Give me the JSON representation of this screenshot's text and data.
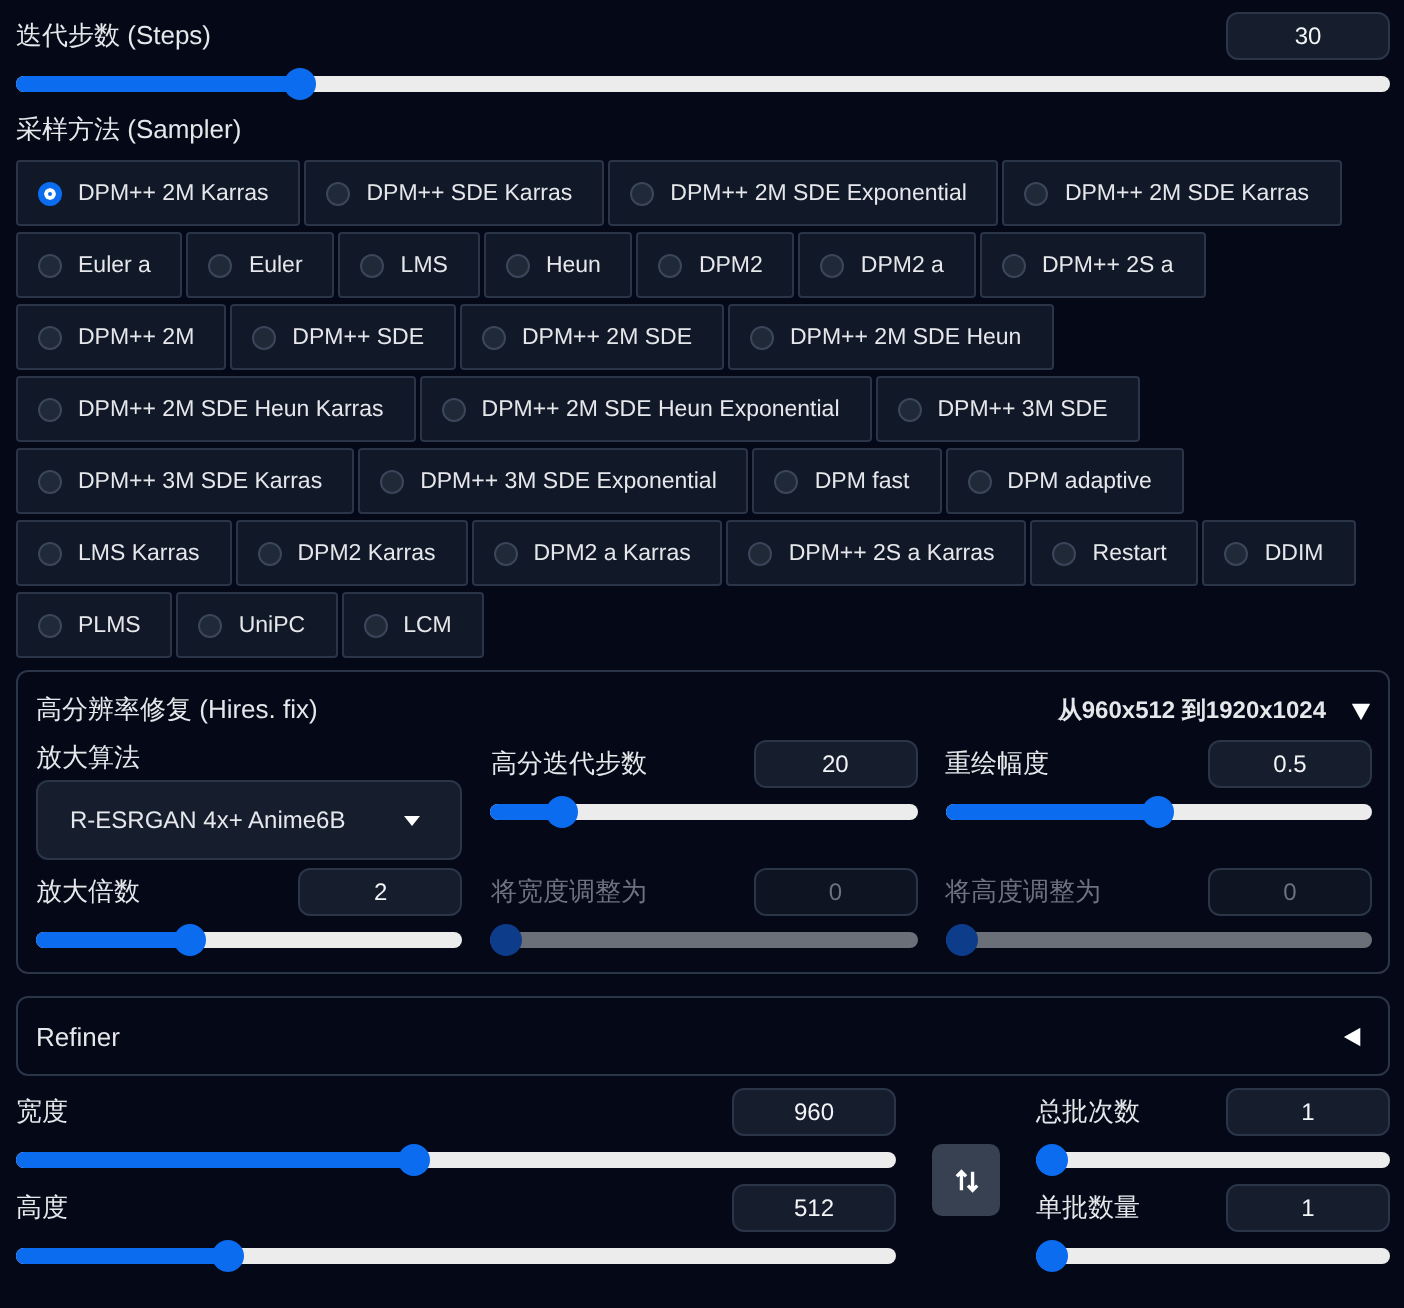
{
  "steps": {
    "label": "迭代步数 (Steps)",
    "value": "30",
    "level": 0.2
  },
  "sampler": {
    "label": "采样方法 (Sampler)",
    "options": [
      {
        "label": "DPM++ 2M Karras",
        "selected": true
      },
      {
        "label": "DPM++ SDE Karras",
        "selected": false
      },
      {
        "label": "DPM++ 2M SDE Exponential",
        "selected": false
      },
      {
        "label": "DPM++ 2M SDE Karras",
        "selected": false
      },
      {
        "label": "Euler a",
        "selected": false
      },
      {
        "label": "Euler",
        "selected": false
      },
      {
        "label": "LMS",
        "selected": false
      },
      {
        "label": "Heun",
        "selected": false
      },
      {
        "label": "DPM2",
        "selected": false
      },
      {
        "label": "DPM2 a",
        "selected": false
      },
      {
        "label": "DPM++ 2S a",
        "selected": false
      },
      {
        "label": "DPM++ 2M",
        "selected": false
      },
      {
        "label": "DPM++ SDE",
        "selected": false
      },
      {
        "label": "DPM++ 2M SDE",
        "selected": false
      },
      {
        "label": "DPM++ 2M SDE Heun",
        "selected": false
      },
      {
        "label": "DPM++ 2M SDE Heun Karras",
        "selected": false
      },
      {
        "label": "DPM++ 2M SDE Heun Exponential",
        "selected": false
      },
      {
        "label": "DPM++ 3M SDE",
        "selected": false
      },
      {
        "label": "DPM++ 3M SDE Karras",
        "selected": false
      },
      {
        "label": "DPM++ 3M SDE Exponential",
        "selected": false
      },
      {
        "label": "DPM fast",
        "selected": false
      },
      {
        "label": "DPM adaptive",
        "selected": false
      },
      {
        "label": "LMS Karras",
        "selected": false
      },
      {
        "label": "DPM2 Karras",
        "selected": false
      },
      {
        "label": "DPM2 a Karras",
        "selected": false
      },
      {
        "label": "DPM++ 2S a Karras",
        "selected": false
      },
      {
        "label": "Restart",
        "selected": false
      },
      {
        "label": "DDIM",
        "selected": false
      },
      {
        "label": "PLMS",
        "selected": false
      },
      {
        "label": "UniPC",
        "selected": false
      },
      {
        "label": "LCM",
        "selected": false
      }
    ]
  },
  "hires_fix": {
    "title": "高分辨率修复 (Hires. fix)",
    "summary": "从960x512 到1920x1024",
    "expanded": true,
    "upscaler": {
      "label": "放大算法",
      "value": "R-ESRGAN 4x+ Anime6B"
    },
    "fields": [
      {
        "label": "高分迭代步数",
        "value": "20",
        "level": 0.14,
        "disabled": false
      },
      {
        "label": "重绘幅度",
        "value": "0.5",
        "level": 0.5,
        "disabled": false
      },
      {
        "label": "放大倍数",
        "value": "2",
        "level": 0.35,
        "disabled": false
      },
      {
        "label": "将宽度调整为",
        "value": "0",
        "level": 0,
        "disabled": true
      },
      {
        "label": "将高度调整为",
        "value": "0",
        "level": 0,
        "disabled": true
      }
    ]
  },
  "refiner": {
    "title": "Refiner",
    "expanded": false
  },
  "size": {
    "width": {
      "label": "宽度",
      "value": "960",
      "level": 0.45
    },
    "height": {
      "label": "高度",
      "value": "512",
      "level": 0.23
    }
  },
  "batch": {
    "count": {
      "label": "总批次数",
      "value": "1",
      "level": 0
    },
    "size": {
      "label": "单批数量",
      "value": "1",
      "level": 0
    }
  }
}
